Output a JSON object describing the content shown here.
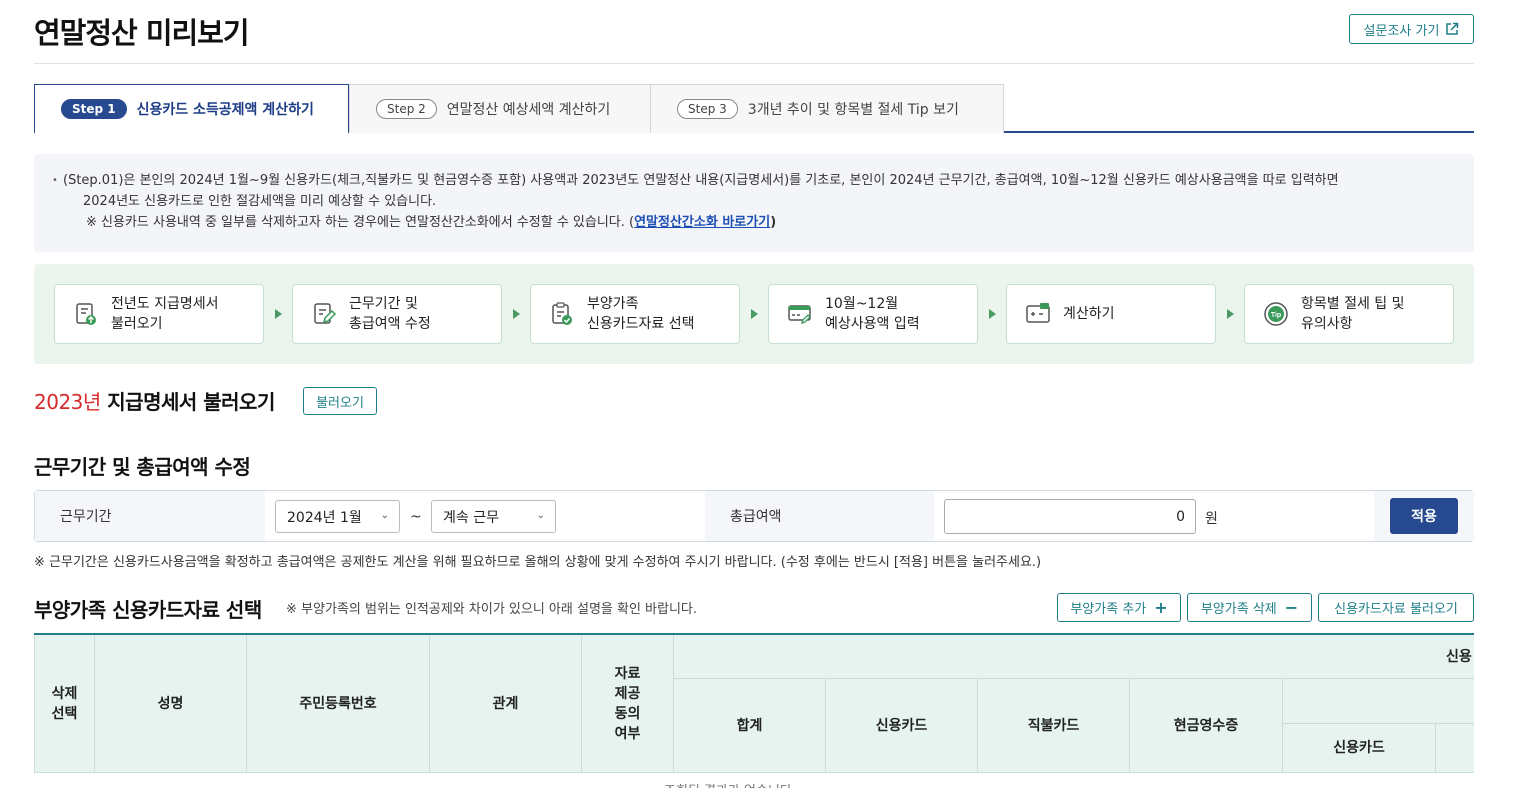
{
  "header": {
    "title": "연말정산 미리보기",
    "survey_label": "설문조사 가기"
  },
  "tabs": [
    {
      "step": "Step 1",
      "label": "신용카드 소득공제액 계산하기"
    },
    {
      "step": "Step 2",
      "label": "연말정산 예상세액 계산하기"
    },
    {
      "step": "Step 3",
      "label": "3개년 추이 및 항목별 절세 Tip 보기"
    }
  ],
  "info": {
    "line1": "(Step.01)은 본인의 2024년 1월~9월 신용카드(체크,직불카드 및 현금영수증 포함) 사용액과 2023년도 연말정산 내용(지급명세서)를 기초로, 본인이 2024년 근무기간, 총급여액, 10월~12월 신용카드 예상사용금액을 따로 입력하면",
    "line2": "2024년도 신용카드로 인한 절감세액을 미리 예상할 수 있습니다.",
    "line3_pre": "※ 신용카드 사용내역 중 일부를 삭제하고자 하는 경우에는 연말정산간소화에서 수정할 수 있습니다. (",
    "line3_link": "연말정산간소화 바로가기",
    "line3_post": ")"
  },
  "steps": [
    {
      "l1": "전년도 지급명세서",
      "l2": "불러오기",
      "icon": "document-upload-icon"
    },
    {
      "l1": "근무기간 및",
      "l2": "총급여액 수정",
      "icon": "edit-document-icon"
    },
    {
      "l1": "부양가족",
      "l2": "신용카드자료 선택",
      "icon": "checklist-icon"
    },
    {
      "l1": "10월~12월",
      "l2": "예상사용액 입력",
      "icon": "card-input-icon"
    },
    {
      "l1": "계산하기",
      "l2": "",
      "icon": "calculator-icon"
    },
    {
      "l1": "항목별 절세 팁 및",
      "l2": "유의사항",
      "icon": "tip-icon"
    }
  ],
  "import": {
    "year": "2023년",
    "title": " 지급명세서 불러오기",
    "button": "불러오기"
  },
  "work": {
    "title": "근무기간 및 총급여액 수정",
    "period_label": "근무기간",
    "start": "2024년 1월",
    "tilde": "~",
    "end": "계속 근무",
    "salary_label": "총급여액",
    "amount": "0",
    "unit": "원",
    "apply": "적용",
    "note": "※ 근무기간은 신용카드사용금액을 확정하고 총급여액은 공제한도 계산을 위해 필요하므로 올해의 상황에 맞게 수정하여 주시기 바랍니다. (수정 후에는 반드시 [적용] 버튼을 눌러주세요.)"
  },
  "dependents": {
    "title": "부양가족 신용카드자료 선택",
    "note": "※ 부양가족의 범위는 인적공제와 차이가 있으니 아래 설명을 확인 바랍니다.",
    "add": "부양가족 추가",
    "delete": "부양가족 삭제",
    "load": "신용카드자료 불러오기",
    "headers": {
      "delete": "삭제\n선택",
      "name": "성명",
      "rrn": "주민등록번호",
      "relation": "관계",
      "consent": "자료\n제공\n동의\n여부",
      "group": "신용",
      "total": "합계",
      "credit": "신용카드",
      "debit": "직불카드",
      "cash": "현금영수증",
      "sub_group": "",
      "sub_credit": "신용카드"
    },
    "empty": "조회된 결과가 없습니다"
  },
  "colors": {
    "primary": "#27498f",
    "teal": "#1e7f88",
    "red": "#d62b2b",
    "green_bg": "#ebf5ee"
  }
}
